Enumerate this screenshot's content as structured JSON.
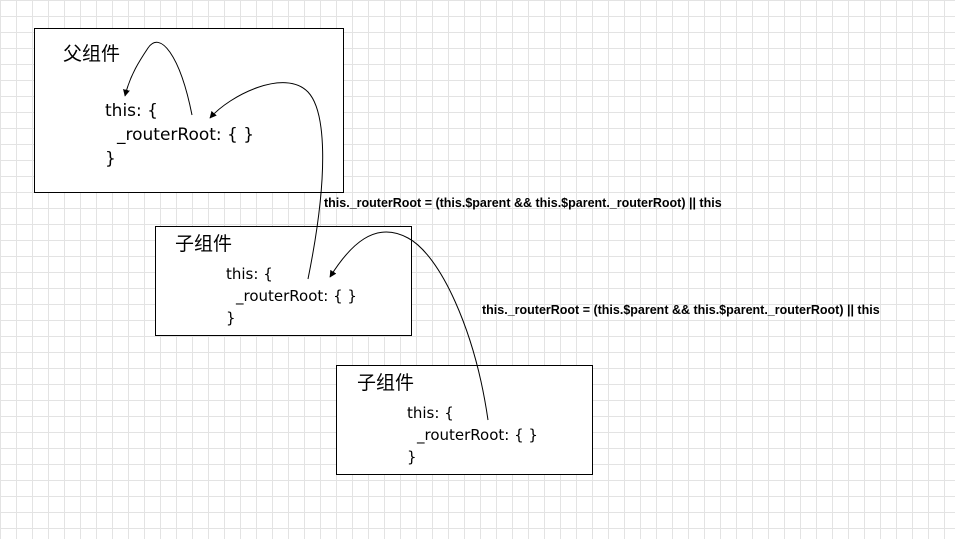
{
  "boxes": [
    {
      "title": "父组件",
      "code": [
        "this: {",
        "_routerRoot: { }",
        "}"
      ]
    },
    {
      "title": "子组件",
      "code": [
        "this: {",
        "_routerRoot: { }",
        "}"
      ]
    },
    {
      "title": "子组件",
      "code": [
        "this: {",
        "_routerRoot: { }",
        "}"
      ]
    }
  ],
  "formulas": [
    "this._routerRoot = (this.$parent && this.$parent._routerRoot) || this",
    "this._routerRoot = (this.$parent && this.$parent._routerRoot) || this"
  ],
  "colors": {
    "background": "#ffffff",
    "grid": "#e3e3e3",
    "stroke": "#000000"
  }
}
